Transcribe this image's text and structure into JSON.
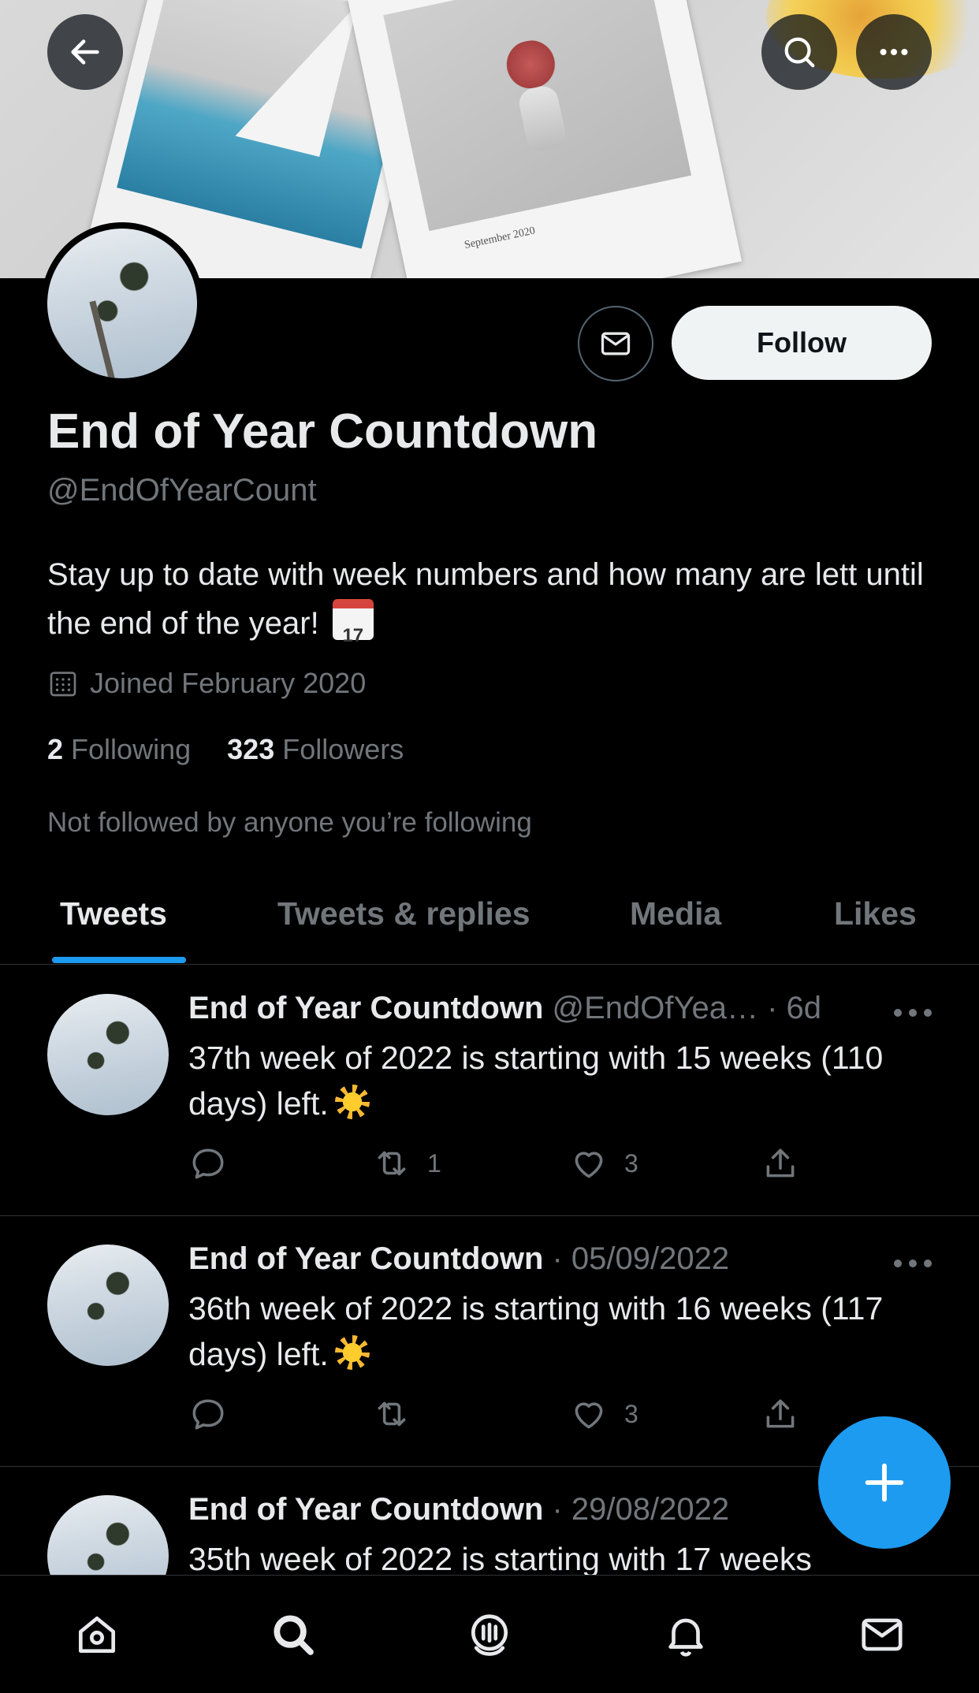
{
  "banner": {
    "calendar_text": "September 2020",
    "back_icon": "arrow-left-icon",
    "search_icon": "search-icon",
    "more_icon": "more-horizontal-icon"
  },
  "profile": {
    "name": "End of Year Countdown",
    "handle": "@EndOfYearCount",
    "bio": "Stay up to date with week numbers and how many are lett until the end of the year!",
    "bio_emoji_text": "17",
    "joined": "Joined February 2020",
    "following_count": "2",
    "following_label": "Following",
    "followers_count": "323",
    "followers_label": "Followers",
    "not_followed": "Not followed by anyone you’re following",
    "follow_label": "Follow"
  },
  "tabs": [
    {
      "label": "Tweets",
      "active": true
    },
    {
      "label": "Tweets & replies",
      "active": false
    },
    {
      "label": "Media",
      "active": false
    },
    {
      "label": "Likes",
      "active": false
    }
  ],
  "tweets": [
    {
      "name": "End of Year Countdown",
      "meta": "@EndOfYea… · 6d",
      "text": "37th week of 2022 is starting with 15 weeks (110 days) left.",
      "retweets": "1",
      "likes": "3"
    },
    {
      "name": "End of Year Countdown",
      "meta": "· 05/09/2022",
      "text": "36th week of 2022 is starting with 16 weeks (117 days) left.",
      "retweets": "",
      "likes": "3"
    },
    {
      "name": "End of Year Countdown",
      "meta": "· 29/08/2022",
      "text": "35th week of 2022 is starting with 17 weeks",
      "retweets": "",
      "likes": ""
    }
  ],
  "colors": {
    "accent": "#1d9bf0",
    "background": "#000000",
    "text_primary": "#e7e9ea",
    "text_secondary": "#71767b"
  },
  "nav": [
    "home-icon",
    "search-icon",
    "spaces-icon",
    "notifications-icon",
    "messages-icon"
  ]
}
